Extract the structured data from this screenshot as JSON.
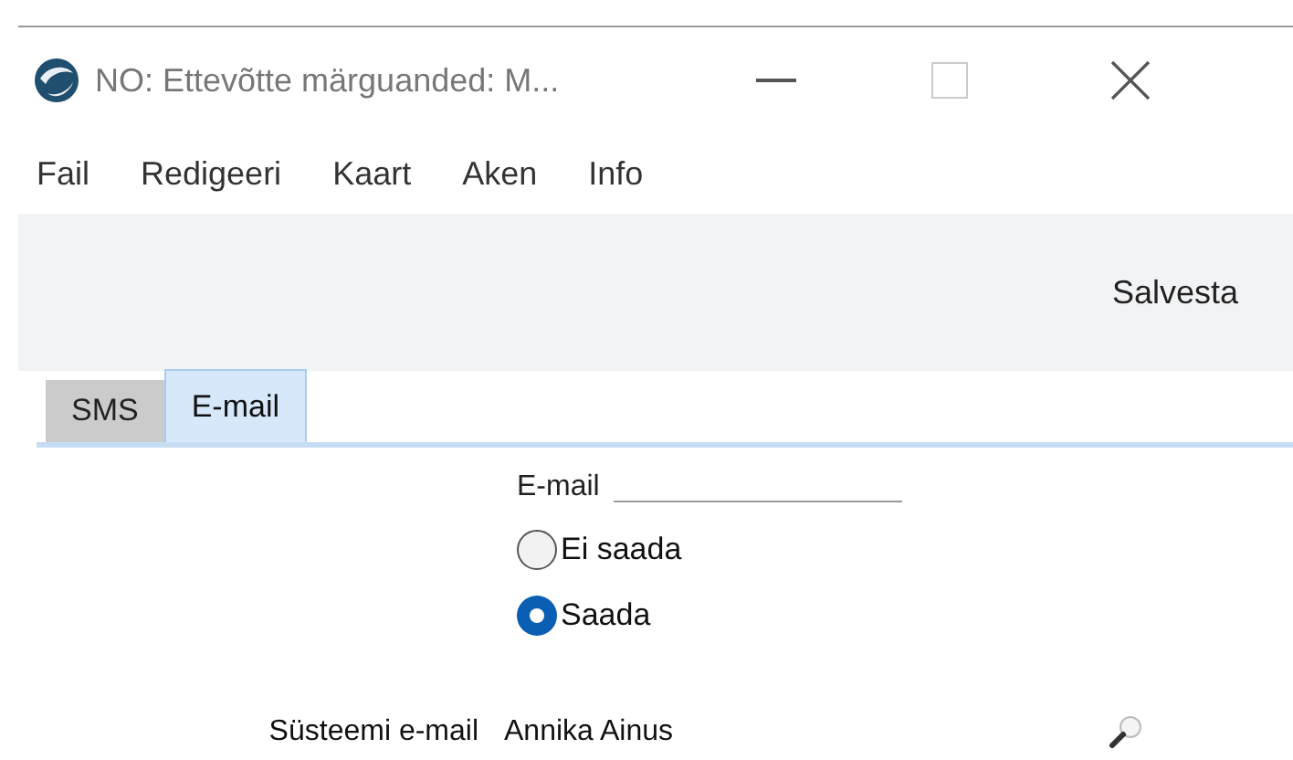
{
  "window": {
    "title": "NO: Ettevõtte märguanded: M..."
  },
  "menu": [
    "Fail",
    "Redigeeri",
    "Kaart",
    "Aken",
    "Info"
  ],
  "toolbar": {
    "buttons": [
      "Salvesta"
    ]
  },
  "tabs": [
    {
      "label": "SMS",
      "selected": false
    },
    {
      "label": "E-mail",
      "selected": true
    }
  ],
  "email_group": {
    "label": "E-mail",
    "options": [
      {
        "label": "Ei saada",
        "selected": false
      },
      {
        "label": "Saada",
        "selected": true
      }
    ]
  },
  "fields": [
    {
      "label": "Süsteemi e-mail",
      "value": "Annika Ainus"
    }
  ]
}
